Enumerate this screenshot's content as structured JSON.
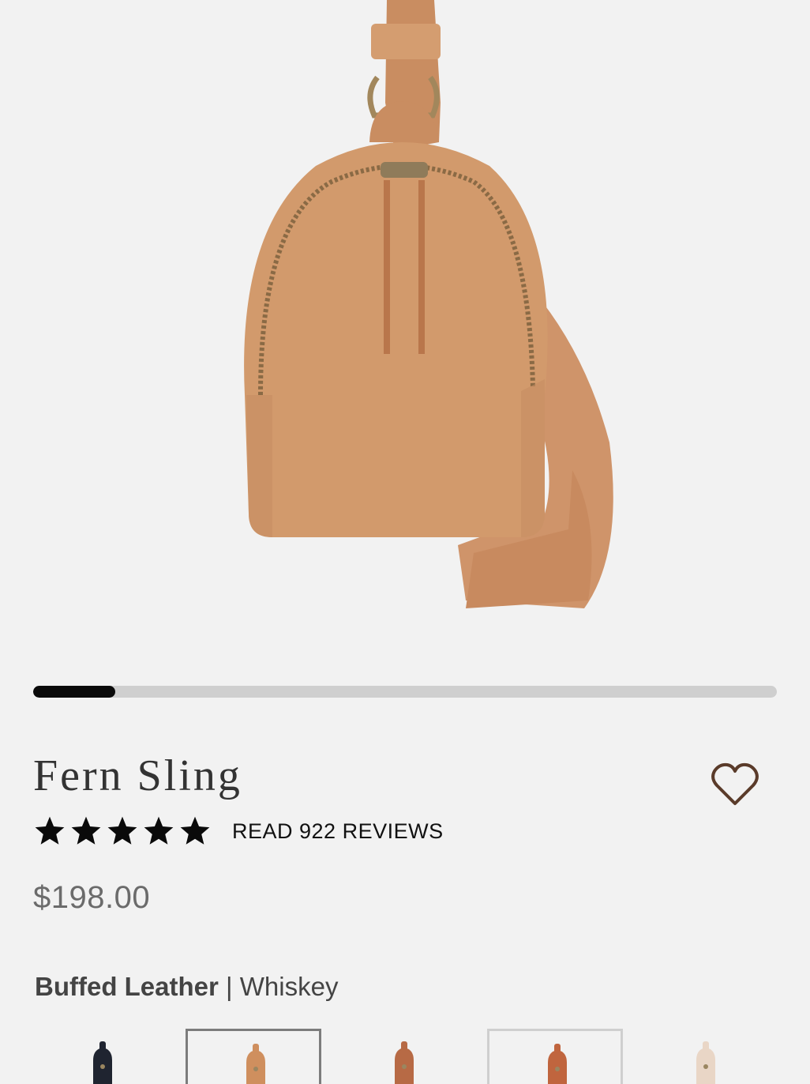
{
  "product": {
    "title": "Fern Sling",
    "rating": 5,
    "reviews_label": "READ 922 REVIEWS",
    "price": "$198.00",
    "material": "Buffed Leather",
    "separator": " | ",
    "color_name": "Whiskey"
  },
  "gallery": {
    "progress": 0.11
  },
  "colors": {
    "leather": "#d29a6c",
    "accent_dark": "#0a0a0a",
    "track": "#cfcfcf"
  },
  "swatches": [
    {
      "color": "#1f2430",
      "state": "default"
    },
    {
      "color": "#cf8f5e",
      "state": "selected"
    },
    {
      "color": "#b76a45",
      "state": "default"
    },
    {
      "color": "#c0653e",
      "state": "outlined"
    },
    {
      "color": "#e9d6c6",
      "state": "default"
    }
  ]
}
